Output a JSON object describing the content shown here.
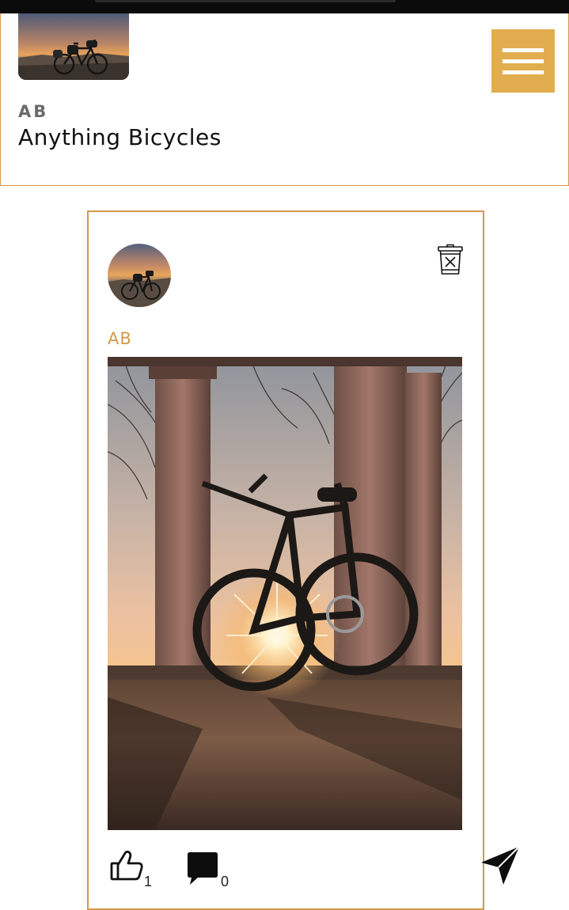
{
  "header": {
    "brand_initials": "AB",
    "brand_name": "Anything Bicycles",
    "menu_icon": "hamburger-menu-icon",
    "thumbnail": "bikepacking-sunset-photo"
  },
  "post": {
    "author": "AB",
    "avatar": "bikepacking-sunset-avatar",
    "image": "bicycle-sunset-columns-photo",
    "likes": "1",
    "comments": "0",
    "delete_icon": "trash-icon",
    "like_icon": "thumbs-up-icon",
    "comment_icon": "comment-bubble-icon",
    "share_icon": "paper-plane-icon"
  },
  "colors": {
    "accent": "#e2ad4f",
    "border": "#d39a47",
    "author_text": "#d39a47"
  }
}
